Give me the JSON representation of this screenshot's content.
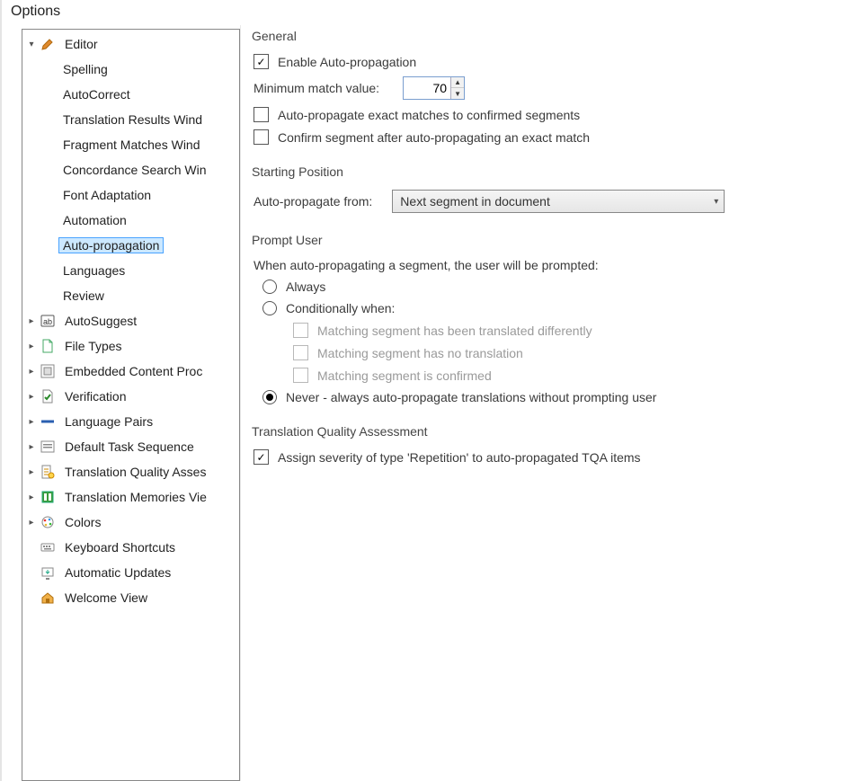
{
  "window": {
    "title": "Options"
  },
  "tree": {
    "items": [
      {
        "label": "Editor",
        "indent": 0,
        "caret": "down",
        "icon": "pencil",
        "selected": false
      },
      {
        "label": "Spelling",
        "indent": 1,
        "caret": "none",
        "icon": "none"
      },
      {
        "label": "AutoCorrect",
        "indent": 1,
        "caret": "none",
        "icon": "none"
      },
      {
        "label": "Translation Results Wind",
        "indent": 1,
        "caret": "none",
        "icon": "none"
      },
      {
        "label": "Fragment Matches Wind",
        "indent": 1,
        "caret": "none",
        "icon": "none"
      },
      {
        "label": "Concordance Search Win",
        "indent": 1,
        "caret": "none",
        "icon": "none"
      },
      {
        "label": "Font Adaptation",
        "indent": 1,
        "caret": "none",
        "icon": "none"
      },
      {
        "label": "Automation",
        "indent": 1,
        "caret": "none",
        "icon": "none"
      },
      {
        "label": "Auto-propagation",
        "indent": 1,
        "caret": "none",
        "icon": "none",
        "selected": true
      },
      {
        "label": "Languages",
        "indent": 1,
        "caret": "none",
        "icon": "none"
      },
      {
        "label": "Review",
        "indent": 1,
        "caret": "none",
        "icon": "none"
      },
      {
        "label": "AutoSuggest",
        "indent": 0,
        "caret": "right",
        "icon": "suggest"
      },
      {
        "label": "File Types",
        "indent": 0,
        "caret": "right",
        "icon": "file"
      },
      {
        "label": "Embedded Content Proc",
        "indent": 0,
        "caret": "right",
        "icon": "embed"
      },
      {
        "label": "Verification",
        "indent": 0,
        "caret": "right",
        "icon": "verify"
      },
      {
        "label": "Language Pairs",
        "indent": 0,
        "caret": "right",
        "icon": "pairs"
      },
      {
        "label": "Default Task Sequence",
        "indent": 0,
        "caret": "right",
        "icon": "task"
      },
      {
        "label": "Translation Quality Asses",
        "indent": 0,
        "caret": "right",
        "icon": "quality"
      },
      {
        "label": "Translation Memories Vie",
        "indent": 0,
        "caret": "right",
        "icon": "tm"
      },
      {
        "label": "Colors",
        "indent": 0,
        "caret": "right",
        "icon": "colors"
      },
      {
        "label": "Keyboard Shortcuts",
        "indent": 0,
        "caret": "none",
        "icon": "keyboard"
      },
      {
        "label": "Automatic Updates",
        "indent": 0,
        "caret": "none",
        "icon": "updates"
      },
      {
        "label": "Welcome View",
        "indent": 0,
        "caret": "none",
        "icon": "home"
      }
    ]
  },
  "general": {
    "legend": "General",
    "enable_label": "Enable Auto-propagation",
    "enable_checked": true,
    "min_match_label": "Minimum match value:",
    "min_match_value": "70",
    "exact_to_confirmed_label": "Auto-propagate exact matches to confirmed segments",
    "exact_to_confirmed_checked": false,
    "confirm_after_label": "Confirm segment after auto-propagating an exact match",
    "confirm_after_checked": false
  },
  "starting": {
    "legend": "Starting Position",
    "from_label": "Auto-propagate from:",
    "from_value": "Next segment in document"
  },
  "prompt": {
    "legend": "Prompt User",
    "intro": "When auto-propagating a segment, the user will be prompted:",
    "opt_always": "Always",
    "opt_cond": "Conditionally when:",
    "cond1": "Matching segment has been translated differently",
    "cond2": "Matching segment has no translation",
    "cond3": "Matching segment is confirmed",
    "opt_never": "Never - always auto-propagate translations without prompting user",
    "selected": "never"
  },
  "tqa": {
    "legend": "Translation Quality Assessment",
    "assign_label": "Assign severity of type 'Repetition' to auto-propagated TQA items",
    "assign_checked": true
  }
}
